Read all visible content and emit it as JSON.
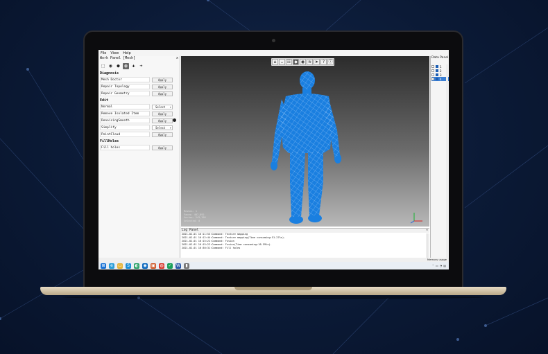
{
  "menu": {
    "items": [
      "File",
      "View",
      "Help"
    ],
    "title_text": "Work Panel [Mesh]"
  },
  "work_panel": {
    "title": "Work Panel [Mesh]",
    "close": "x",
    "icons": [
      "cube-icon",
      "eye-icon",
      "sphere-icon",
      "mesh-sphere-icon",
      "puzzle-icon",
      "arrow-icon"
    ],
    "sections": [
      {
        "name": "Diagnosis",
        "rows": [
          {
            "label": "Mesh Doctor",
            "control": "Apply",
            "type": "button"
          },
          {
            "label": "Repair Topology",
            "control": "Apply",
            "type": "button"
          },
          {
            "label": "Repair Geometry",
            "control": "Apply",
            "type": "button"
          }
        ]
      },
      {
        "name": "Edit",
        "rows": [
          {
            "label": "Normal",
            "control": "Select",
            "type": "select"
          },
          {
            "label": "Remove Isolated Item",
            "control": "Apply",
            "type": "button"
          },
          {
            "label": "DenoisingSmooth",
            "control": "Apply",
            "type": "button"
          },
          {
            "label": "Simplify",
            "control": "Select",
            "type": "select"
          },
          {
            "label": "PointCloud",
            "control": "Apply",
            "type": "button"
          }
        ]
      },
      {
        "name": "FillHoles",
        "rows": [
          {
            "label": "Fill holes",
            "control": "Apply",
            "type": "button"
          }
        ]
      }
    ]
  },
  "viewport": {
    "toolbar": [
      "home-icon",
      "fit-icon",
      "grid-icon",
      "select-icon",
      "eye-icon",
      "layers-icon",
      "pointer-icon",
      "help-icon",
      "info-icon"
    ],
    "toolbar_glyphs": [
      "⌂",
      "⌄",
      "☷",
      "◆",
      "◉",
      "≋",
      "➤",
      "?",
      "ⓘ"
    ],
    "overlay": [
      "Meshes: 1",
      "Faces: 487,892",
      "Vertex: 243,768",
      "Selected: 0"
    ],
    "model_color": "#1a7fe0"
  },
  "data_panel": {
    "title": "Data Panel",
    "rows": [
      "1",
      "2",
      "3",
      "4"
    ],
    "selected_index": 3
  },
  "log_panel": {
    "title": "Log Panel",
    "lines": [
      "2021-02-01 16:11:53:Command: Texture mapping",
      "2021-02-01 16:12:44:Command: Texture mapping(Time consuming:51.27%s).",
      "2021-02-01 16:15:22:Command: Fusion",
      "2021-02-01 16:15:22:Command: Fusion(Time consuming:16.59%s).",
      "2021-02-01 16:30:31:Command: Fill holes"
    ]
  },
  "status": {
    "text": "Memory usage"
  },
  "taskbar": {
    "icons": [
      {
        "name": "windows-start-icon",
        "glyph": "⊞",
        "color": "#1a73d6"
      },
      {
        "name": "edge-icon",
        "glyph": "e",
        "color": "#2b9ed8"
      },
      {
        "name": "file-explorer-icon",
        "glyph": "▭",
        "color": "#e6b43a"
      },
      {
        "name": "skype-icon",
        "glyph": "S",
        "color": "#1b8fd8"
      },
      {
        "name": "edge-new-icon",
        "glyph": "◐",
        "color": "#2fa36a"
      },
      {
        "name": "browser-icon",
        "glyph": "◉",
        "color": "#0f6abf"
      },
      {
        "name": "store-icon",
        "glyph": "▣",
        "color": "#d05a2a"
      },
      {
        "name": "chrome-icon",
        "glyph": "◍",
        "color": "#d93b30"
      },
      {
        "name": "app-green-icon",
        "glyph": "✓",
        "color": "#1aa05a"
      },
      {
        "name": "word-icon",
        "glyph": "W",
        "color": "#2b5aa9"
      },
      {
        "name": "scan-app-icon",
        "glyph": "▮",
        "color": "#777777"
      }
    ],
    "tray": [
      "⌃",
      "▭",
      "◔",
      "▤"
    ]
  }
}
